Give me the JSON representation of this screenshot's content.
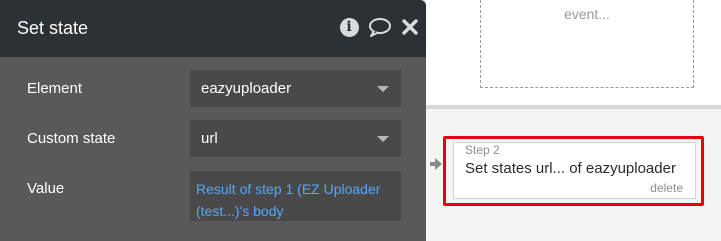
{
  "panel": {
    "title": "Set state",
    "icons": [
      "info-icon",
      "comment-icon",
      "close-icon"
    ],
    "fields": {
      "element": {
        "label": "Element",
        "value": "eazyuploader"
      },
      "custom_state": {
        "label": "Custom state",
        "value": "url"
      },
      "value": {
        "label": "Value",
        "expression": "Result of step 1 (EZ Uploader (test...)'s body"
      }
    }
  },
  "canvas": {
    "event_placeholder": "event...",
    "step": {
      "number": "Step 2",
      "title": "Set states url... of eazyuploader",
      "delete_label": "delete"
    }
  },
  "colors": {
    "panel_header": "#2c3135",
    "panel_body": "#595959",
    "field_bg": "#494949",
    "expression_text": "#57a6f8",
    "highlight": "#e8000b"
  }
}
